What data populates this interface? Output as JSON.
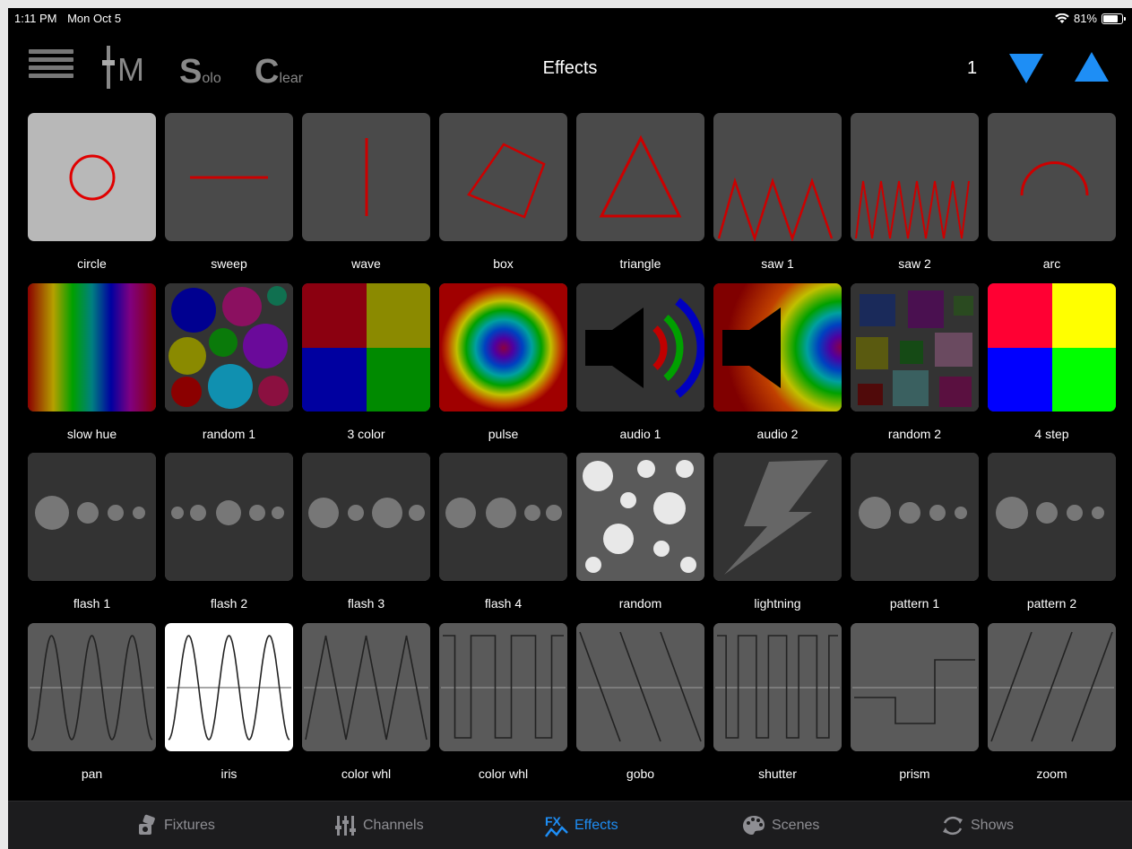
{
  "status": {
    "time": "1:11 PM",
    "date": "Mon Oct 5",
    "battery": "81%",
    "battery_level": 0.81
  },
  "header": {
    "menu_icon": "hamburger-icon",
    "im_label": "M",
    "solo_big": "S",
    "solo_small": "olo",
    "clear_big": "C",
    "clear_small": "lear",
    "title": "Effects",
    "page": "1"
  },
  "colors": {
    "accent": "#1e8ef5",
    "tile": "#4a4a4a",
    "tile_dark": "#2f2f2f",
    "line_red": "#c00000"
  },
  "effects": [
    "circle",
    "sweep",
    "wave",
    "box",
    "triangle",
    "saw 1",
    "saw 2",
    "arc",
    "slow hue",
    "random 1",
    "3 color",
    "pulse",
    "audio 1",
    "audio 2",
    "random 2",
    "4 step",
    "flash 1",
    "flash 2",
    "flash 3",
    "flash 4",
    "random",
    "lightning",
    "pattern 1",
    "pattern 2",
    "pan",
    "iris",
    "color whl",
    "color whl",
    "gobo",
    "shutter",
    "prism",
    "zoom"
  ],
  "tabs": [
    {
      "label": "Fixtures",
      "icon": "fixture-icon"
    },
    {
      "label": "Channels",
      "icon": "sliders-icon"
    },
    {
      "label": "Effects",
      "icon": "fx-icon",
      "active": true
    },
    {
      "label": "Scenes",
      "icon": "palette-icon"
    },
    {
      "label": "Shows",
      "icon": "cycle-icon"
    }
  ]
}
